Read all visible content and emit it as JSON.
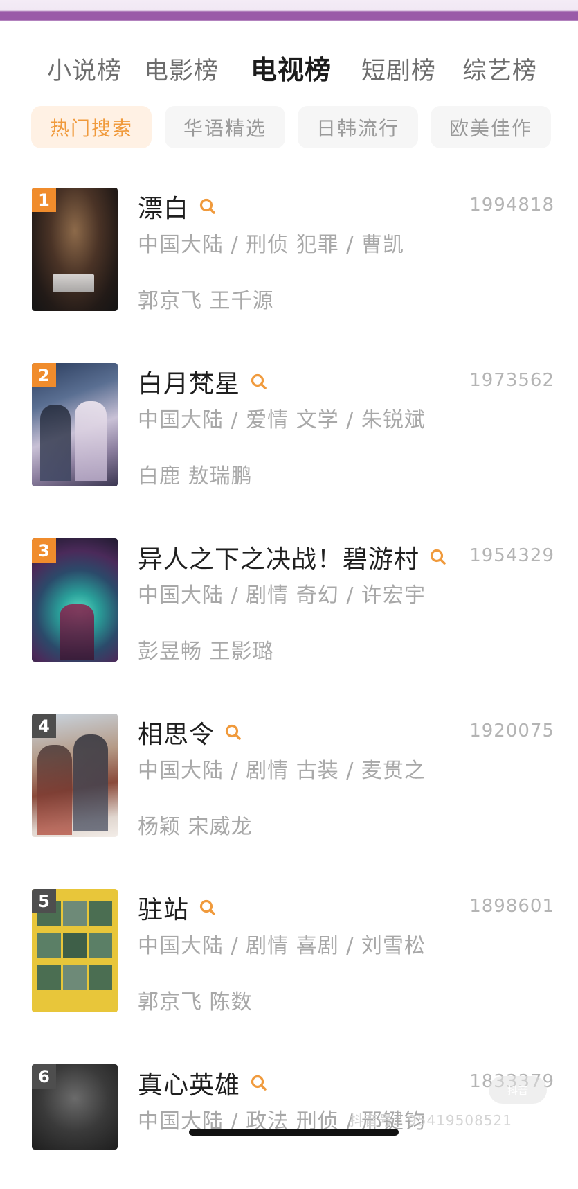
{
  "main_tabs": [
    {
      "label": "小说榜",
      "active": false
    },
    {
      "label": "电影榜",
      "active": false
    },
    {
      "label": "电视榜",
      "active": true
    },
    {
      "label": "短剧榜",
      "active": false
    },
    {
      "label": "综艺榜",
      "active": false
    }
  ],
  "sub_tabs": [
    {
      "label": "热门搜索",
      "active": true
    },
    {
      "label": "华语精选",
      "active": false
    },
    {
      "label": "日韩流行",
      "active": false
    },
    {
      "label": "欧美佳作",
      "active": false
    }
  ],
  "items": [
    {
      "rank": "1",
      "title": "漂白",
      "score": "1994818",
      "meta": "中国大陆 / 刑侦 犯罪 / 曹凯",
      "cast": "郭京飞 王千源",
      "rank_color": "#f08c2c",
      "poster_icon": "poster-piaobai"
    },
    {
      "rank": "2",
      "title": "白月梵星",
      "score": "1973562",
      "meta": "中国大陆 / 爱情 文学 / 朱锐斌",
      "cast": "白鹿 敖瑞鹏",
      "rank_color": "#f08c2c",
      "poster_icon": "poster-baiyuefanxing"
    },
    {
      "rank": "3",
      "title": "异人之下之决战！碧游村",
      "score": "1954329",
      "meta": "中国大陆 / 剧情 奇幻 / 许宏宇",
      "cast": "彭昱畅 王影璐",
      "rank_color": "#f08c2c",
      "poster_icon": "poster-yirenzhixia"
    },
    {
      "rank": "4",
      "title": "相思令",
      "score": "1920075",
      "meta": "中国大陆 / 剧情 古装 / 麦贯之",
      "cast": "杨颖 宋威龙",
      "rank_color": "#4e4e4e",
      "poster_icon": "poster-xiangsiling"
    },
    {
      "rank": "5",
      "title": "驻站",
      "score": "1898601",
      "meta": "中国大陆 / 剧情 喜剧 / 刘雪松",
      "cast": "郭京飞 陈数",
      "rank_color": "#4e4e4e",
      "poster_icon": "poster-zhuzhan"
    },
    {
      "rank": "6",
      "title": "真心英雄",
      "score": "1833379",
      "meta": "中国大陆 / 政法 刑侦 / 邢键钧",
      "cast": "",
      "rank_color": "#4e4e4e",
      "poster_icon": "poster-zhenxinyingxiong"
    }
  ],
  "accent_color": "#f09a3c",
  "watermark_text": "抖音号：95419508521",
  "watermark_badge": "抖音"
}
